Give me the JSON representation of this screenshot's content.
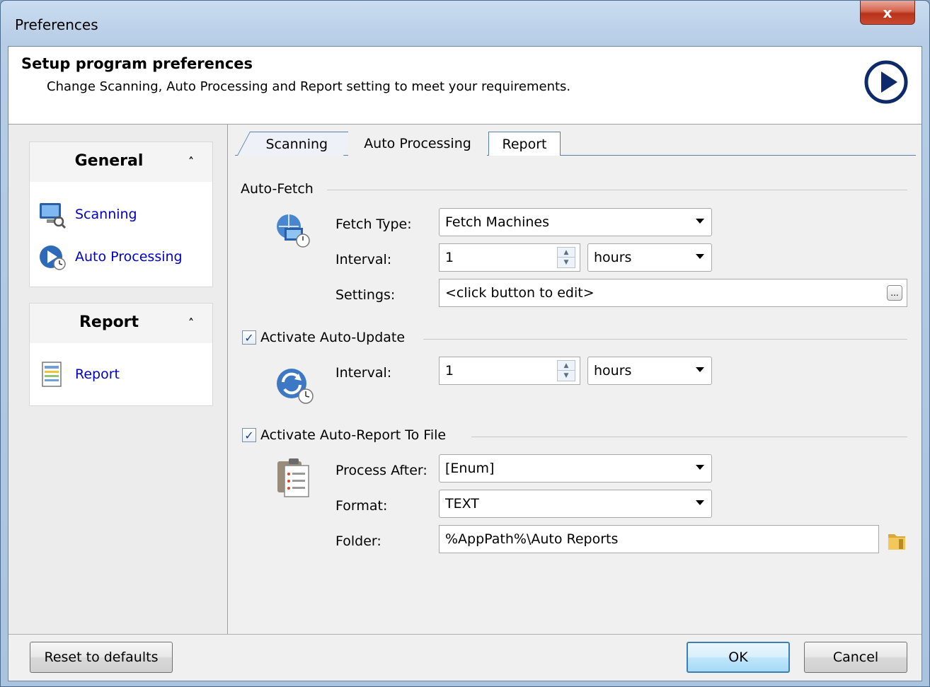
{
  "window": {
    "title": "Preferences",
    "close_label": "x"
  },
  "header": {
    "title": "Setup program preferences",
    "subtitle": "Change Scanning, Auto Processing and Report setting to meet your requirements."
  },
  "sidebar": {
    "groups": [
      {
        "title": "General",
        "collapse_glyph": "˄",
        "items": [
          {
            "label": "Scanning"
          },
          {
            "label": "Auto Processing"
          }
        ]
      },
      {
        "title": "Report",
        "collapse_glyph": "˄",
        "items": [
          {
            "label": "Report"
          }
        ]
      }
    ]
  },
  "tabs": [
    {
      "label": "Scanning"
    },
    {
      "label": "Auto Processing",
      "selected": true
    },
    {
      "label": "Report"
    }
  ],
  "auto_fetch": {
    "section_label": "Auto-Fetch",
    "fetch_type_label": "Fetch Type:",
    "fetch_type_value": "Fetch Machines",
    "interval_label": "Interval:",
    "interval_value": "1",
    "interval_unit": "hours",
    "settings_label": "Settings:",
    "settings_value": "<click button to edit>",
    "settings_button": "..."
  },
  "auto_update": {
    "section_label": "Activate Auto-Update",
    "checked": true,
    "interval_label": "Interval:",
    "interval_value": "1",
    "interval_unit": "hours"
  },
  "auto_report": {
    "section_label": "Activate Auto-Report To File",
    "checked": true,
    "process_after_label": "Process After:",
    "process_after_value": "[Enum]",
    "format_label": "Format:",
    "format_value": "TEXT",
    "folder_label": "Folder:",
    "folder_value": "%AppPath%\\Auto Reports"
  },
  "footer": {
    "reset_label": "Reset to defaults",
    "ok_label": "OK",
    "cancel_label": "Cancel"
  },
  "colors": {
    "link": "#0000cc",
    "tab_border": "#5c7fa8",
    "default_button": "#3c7fb1"
  }
}
